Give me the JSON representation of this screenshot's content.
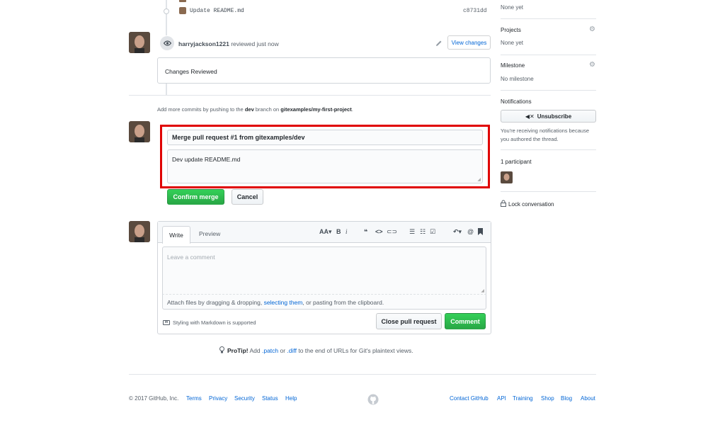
{
  "commits": [
    {
      "message": "Update README.md",
      "sha": "c8731dd"
    }
  ],
  "review": {
    "user": "harryjackson1221",
    "action": "reviewed just now",
    "view_changes": "View changes",
    "body": "Changes Reviewed"
  },
  "push_hint": {
    "prefix": "Add more commits by pushing to the ",
    "branch": "dev",
    "middle": " branch on ",
    "repo": "gitexamples/my-first-project",
    "suffix": "."
  },
  "merge": {
    "title_value": "Merge pull request #1 from gitexamples/dev",
    "body_value": "Dev update README.md",
    "confirm": "Confirm merge",
    "cancel": "Cancel",
    "highlight_color": "#e00000"
  },
  "comment_box": {
    "tab_write": "Write",
    "tab_preview": "Preview",
    "placeholder": "Leave a comment",
    "attach_prefix": "Attach files by dragging & dropping, ",
    "attach_link": "selecting them",
    "attach_suffix": ", or pasting from the clipboard.",
    "markdown_note": "Styling with Markdown is supported",
    "close_pr": "Close pull request",
    "comment": "Comment"
  },
  "protip": {
    "label": "ProTip!",
    "t1": " Add ",
    "patch": ".patch",
    "t2": " or ",
    "diff": ".diff",
    "t3": " to the end of URLs for Git's plaintext views."
  },
  "sidebar": {
    "reviewers_value": "None yet",
    "projects_title": "Projects",
    "projects_value": "None yet",
    "milestone_title": "Milestone",
    "milestone_value": "No milestone",
    "notifications_title": "Notifications",
    "unsubscribe": "Unsubscribe",
    "notif_reason_1": "You're receiving notifications because",
    "notif_reason_2": "you authored the thread.",
    "participants": "1 participant",
    "lock": "Lock conversation"
  },
  "footer": {
    "copyright": "© 2017 GitHub, Inc.",
    "left_links": [
      "Terms",
      "Privacy",
      "Security",
      "Status",
      "Help"
    ],
    "right_links": [
      "Contact GitHub",
      "API",
      "Training",
      "Shop",
      "Blog",
      "About"
    ]
  },
  "colors": {
    "link": "#0366d6",
    "green": "#28a745",
    "border": "#d1d5da"
  }
}
